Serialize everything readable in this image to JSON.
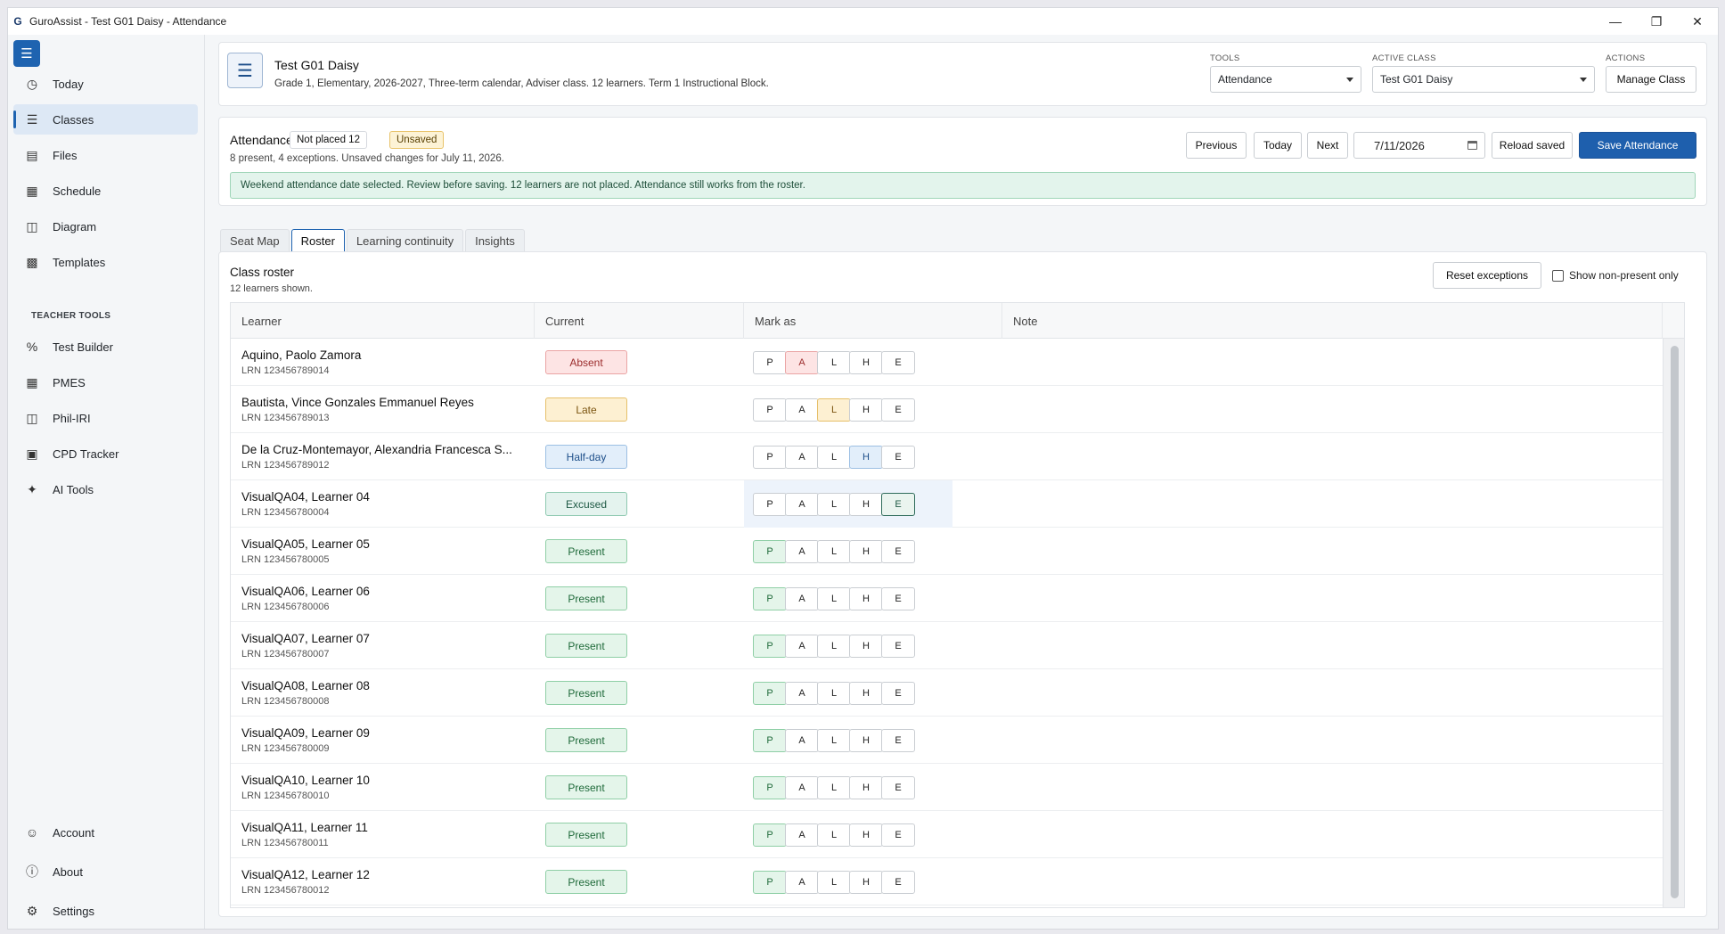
{
  "window": {
    "title": "GuroAssist - Test G01 Daisy - Attendance",
    "controls": [
      "minimize",
      "restore",
      "close"
    ]
  },
  "sidebar": {
    "items": [
      {
        "label": "Today",
        "icon": "clock-icon"
      },
      {
        "label": "Classes",
        "icon": "list-icon",
        "active": true
      },
      {
        "label": "Files",
        "icon": "file-icon"
      },
      {
        "label": "Schedule",
        "icon": "calendar-icon"
      },
      {
        "label": "Diagram",
        "icon": "diagram-icon"
      },
      {
        "label": "Templates",
        "icon": "template-icon"
      }
    ],
    "section_label": "TEACHER TOOLS",
    "tools": [
      {
        "label": "Test Builder",
        "icon": "percent-icon"
      },
      {
        "label": "PMES",
        "icon": "grid-icon"
      },
      {
        "label": "Phil-IRI",
        "icon": "book-icon"
      },
      {
        "label": "CPD Tracker",
        "icon": "tracker-icon"
      },
      {
        "label": "AI Tools",
        "icon": "wand-icon"
      }
    ],
    "bottom": [
      {
        "label": "Account",
        "icon": "account-icon"
      },
      {
        "label": "About",
        "icon": "info-icon"
      },
      {
        "label": "Settings",
        "icon": "gear-icon"
      }
    ]
  },
  "class_header": {
    "title": "Test G01 Daisy",
    "subtitle": "Grade 1, Elementary, 2026-2027, Three-term calendar, Adviser class. 12 learners. Term 1 Instructional Block.",
    "tools_label": "TOOLS",
    "tools_value": "Attendance",
    "active_class_label": "ACTIVE CLASS",
    "active_class_value": "Test G01 Daisy",
    "actions_label": "ACTIONS",
    "manage_class": "Manage Class"
  },
  "attendance": {
    "title": "Attendance",
    "not_placed": "Not placed 12",
    "unsaved": "Unsaved",
    "summary": "8 present, 4 exceptions. Unsaved changes for July 11, 2026.",
    "previous": "Previous",
    "today": "Today",
    "next": "Next",
    "date": "7/11/2026",
    "reload": "Reload saved",
    "save": "Save Attendance",
    "banner": "Weekend attendance date selected. Review before saving. 12 learners are not placed. Attendance still works from the roster."
  },
  "tabs": [
    "Seat Map",
    "Roster",
    "Learning continuity",
    "Insights"
  ],
  "active_tab": "Roster",
  "roster": {
    "title": "Class roster",
    "subtitle": "12 learners shown.",
    "reset": "Reset exceptions",
    "show_non_present": "Show non-present only",
    "columns": [
      "Learner",
      "Current",
      "Mark as",
      "Note"
    ],
    "mark_options": [
      "P",
      "A",
      "L",
      "H",
      "E"
    ],
    "status_colors": {
      "Absent": {
        "bg": "#fde4e4",
        "border": "#eaa4a4",
        "fg": "#9b2c2c"
      },
      "Late": {
        "bg": "#fdf0d2",
        "border": "#e6c06a",
        "fg": "#7a5410"
      },
      "Half-day": {
        "bg": "#e2eefa",
        "border": "#9cbfe3",
        "fg": "#1e4f8a"
      },
      "Excused": {
        "bg": "#e4f3ee",
        "border": "#8ec9b0",
        "fg": "#1f5a45"
      },
      "Present": {
        "bg": "#e4f5ea",
        "border": "#8fcfa6",
        "fg": "#1f6a3a"
      }
    },
    "rows": [
      {
        "name": "Aquino, Paolo Zamora",
        "lrn": "LRN 123456789014",
        "status": "Absent",
        "mark": "A"
      },
      {
        "name": "Bautista, Vince Gonzales Emmanuel Reyes",
        "lrn": "LRN 123456789013",
        "status": "Late",
        "mark": "L"
      },
      {
        "name": "De la Cruz-Montemayor, Alexandria Francesca S...",
        "lrn": "LRN 123456789012",
        "status": "Half-day",
        "mark": "H"
      },
      {
        "name": "VisualQA04, Learner 04",
        "lrn": "LRN 123456780004",
        "status": "Excused",
        "mark": "E",
        "highlight": true
      },
      {
        "name": "VisualQA05, Learner 05",
        "lrn": "LRN 123456780005",
        "status": "Present",
        "mark": "P"
      },
      {
        "name": "VisualQA06, Learner 06",
        "lrn": "LRN 123456780006",
        "status": "Present",
        "mark": "P"
      },
      {
        "name": "VisualQA07, Learner 07",
        "lrn": "LRN 123456780007",
        "status": "Present",
        "mark": "P"
      },
      {
        "name": "VisualQA08, Learner 08",
        "lrn": "LRN 123456780008",
        "status": "Present",
        "mark": "P"
      },
      {
        "name": "VisualQA09, Learner 09",
        "lrn": "LRN 123456780009",
        "status": "Present",
        "mark": "P"
      },
      {
        "name": "VisualQA10, Learner 10",
        "lrn": "LRN 123456780010",
        "status": "Present",
        "mark": "P"
      },
      {
        "name": "VisualQA11, Learner 11",
        "lrn": "LRN 123456780011",
        "status": "Present",
        "mark": "P"
      },
      {
        "name": "VisualQA12, Learner 12",
        "lrn": "LRN 123456780012",
        "status": "Present",
        "mark": "P"
      }
    ]
  }
}
